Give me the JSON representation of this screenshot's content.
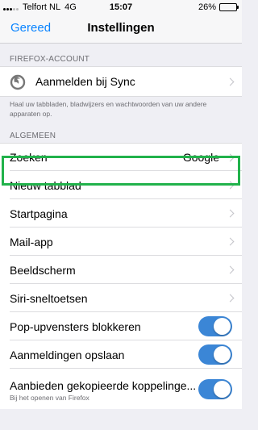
{
  "status_bar": {
    "carrier": "Telfort NL",
    "network": "4G",
    "time": "15:07",
    "battery_percent": "26%",
    "battery_level": 0.26
  },
  "nav": {
    "done_label": "Gereed",
    "title": "Instellingen"
  },
  "firefox_account": {
    "header": "FIREFOX-ACCOUNT",
    "sync_label": "Aanmelden bij Sync",
    "sync_icon": "firefox-sync-icon",
    "description": "Haal uw tabbladen, bladwijzers en wachtwoorden van uw andere apparaten op."
  },
  "general": {
    "header": "ALGEMEEN",
    "items": [
      {
        "label": "Zoeken",
        "detail": "Google"
      },
      {
        "label": "Nieuw tabblad"
      },
      {
        "label": "Startpagina"
      },
      {
        "label": "Mail-app"
      },
      {
        "label": "Beeldscherm"
      },
      {
        "label": "Siri-sneltoetsen"
      }
    ],
    "toggles": [
      {
        "label": "Pop-upvensters blokkeren",
        "on": true
      },
      {
        "label": "Aanmeldingen opslaan",
        "on": true
      },
      {
        "label": "Aanbieden gekopieerde koppelinge...",
        "sublabel": "Bij het openen van Firefox",
        "on": true
      }
    ]
  },
  "colors": {
    "accent": "#0a84ff",
    "toggle_on": "#3b86d6",
    "highlight": "#21b24b"
  }
}
